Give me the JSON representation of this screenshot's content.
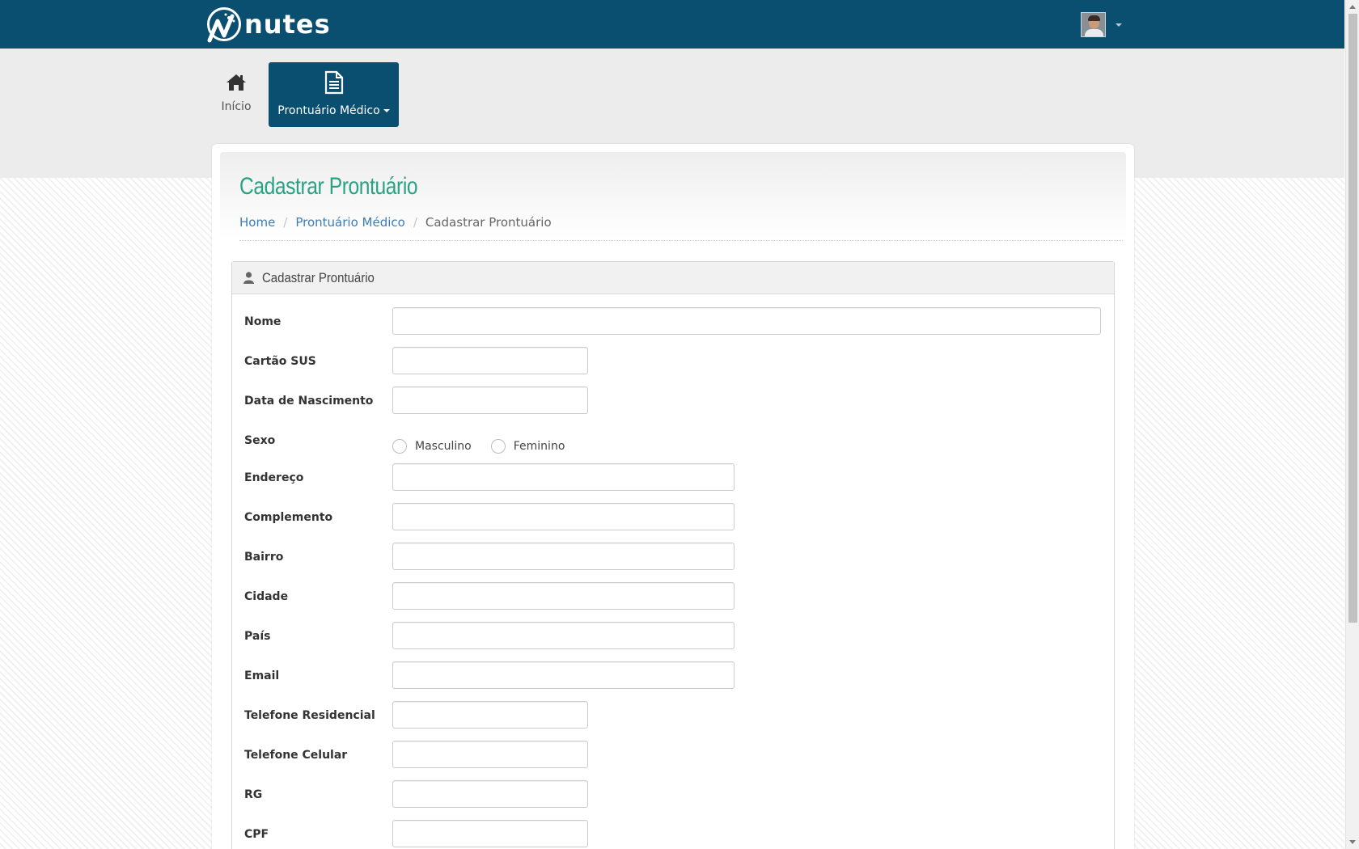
{
  "brand": {
    "name": "nutes"
  },
  "nav": {
    "home_label": "Início",
    "prontuario_label": "Prontuário Médico"
  },
  "page": {
    "title": "Cadastrar Prontuário",
    "breadcrumb": [
      "Home",
      "Prontuário Médico",
      "Cadastrar Prontuário"
    ]
  },
  "panel": {
    "title": "Cadastrar Prontuário"
  },
  "form": {
    "nome": {
      "label": "Nome",
      "value": ""
    },
    "cartao_sus": {
      "label": "Cartão SUS",
      "value": ""
    },
    "data_nascimento": {
      "label": "Data de Nascimento",
      "value": ""
    },
    "sexo": {
      "label": "Sexo",
      "options": [
        "Masculino",
        "Feminino"
      ],
      "selected": null
    },
    "endereco": {
      "label": "Endereço",
      "value": ""
    },
    "complemento": {
      "label": "Complemento",
      "value": ""
    },
    "bairro": {
      "label": "Bairro",
      "value": ""
    },
    "cidade": {
      "label": "Cidade",
      "value": ""
    },
    "pais": {
      "label": "País",
      "value": ""
    },
    "email": {
      "label": "Email",
      "value": ""
    },
    "telefone_residencial": {
      "label": "Telefone Residencial",
      "value": ""
    },
    "telefone_celular": {
      "label": "Telefone Celular",
      "value": ""
    },
    "rg": {
      "label": "RG",
      "value": ""
    },
    "cpf": {
      "label": "CPF",
      "value": ""
    }
  },
  "colors": {
    "navbar": "#0a4f70",
    "title": "#25a383",
    "link": "#3b7db8"
  },
  "icons": {
    "home": "home-icon",
    "prontuario": "document-icon",
    "panel": "user-icon"
  }
}
